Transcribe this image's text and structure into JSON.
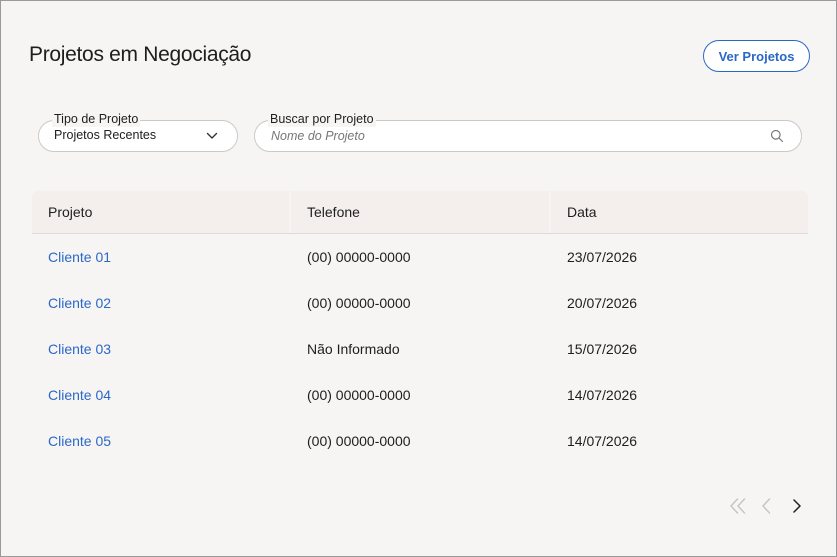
{
  "header": {
    "title": "Projetos em Negociação",
    "ver_projetos_label": "Ver Projetos"
  },
  "filters": {
    "tipo": {
      "label": "Tipo de Projeto",
      "selected": "Projetos Recentes"
    },
    "busca": {
      "label": "Buscar por Projeto",
      "placeholder": "Nome do Projeto",
      "value": ""
    }
  },
  "table": {
    "columns": [
      "Projeto",
      "Telefone",
      "Data"
    ],
    "rows": [
      {
        "projeto": "Cliente 01",
        "telefone": "(00) 00000-0000",
        "data": "23/07/2026"
      },
      {
        "projeto": "Cliente 02",
        "telefone": "(00) 00000-0000",
        "data": "20/07/2026"
      },
      {
        "projeto": "Cliente 03",
        "telefone": "Não Informado",
        "data": "15/07/2026"
      },
      {
        "projeto": "Cliente 04",
        "telefone": "(00) 00000-0000",
        "data": "14/07/2026"
      },
      {
        "projeto": "Cliente 05",
        "telefone": "(00) 00000-0000",
        "data": "14/07/2026"
      }
    ]
  },
  "pagination": {
    "first_icon": "double-chevron-left-icon",
    "prev_icon": "chevron-left-icon",
    "next_icon": "chevron-right-icon"
  },
  "colors": {
    "accent": "#2a68c8",
    "background": "#f7f5f3",
    "header_row": "#f4efec",
    "disabled": "#c4c4c4"
  }
}
